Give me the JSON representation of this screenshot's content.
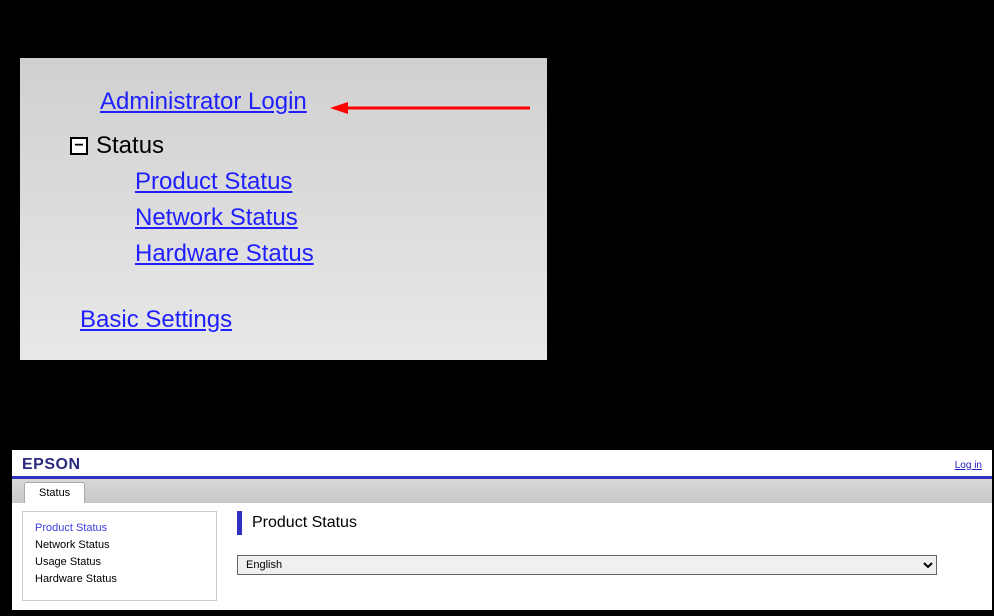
{
  "top_panel": {
    "admin_login": "Administrator Login",
    "status_label": "Status",
    "collapse_symbol": "−",
    "sub_links": {
      "product_status": "Product Status",
      "network_status": "Network Status",
      "hardware_status": "Hardware Status"
    },
    "basic_settings": "Basic Settings"
  },
  "bottom_panel": {
    "logo": "EPSON",
    "login": "Log in",
    "tab": "Status",
    "sidebar": {
      "product_status": "Product Status",
      "network_status": "Network Status",
      "usage_status": "Usage Status",
      "hardware_status": "Hardware Status"
    },
    "page_title": "Product Status",
    "language_selected": "English"
  }
}
